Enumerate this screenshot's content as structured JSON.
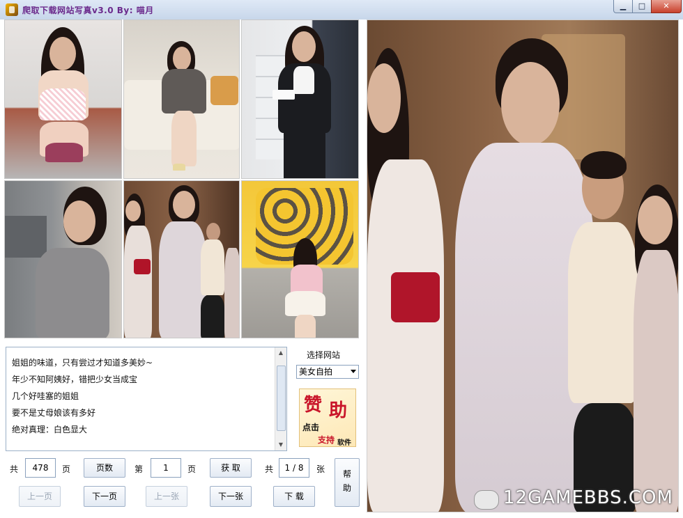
{
  "window": {
    "title": "爬取下载网站写真v3.0    By:  喵月",
    "minimize_glyph": "▁",
    "maximize_glyph": "□",
    "close_glyph": "✕"
  },
  "description": {
    "lines": [
      "姐姐的味道，只有尝过才知道多美妙~",
      "年少不知阿姨好，错把少女当成宝",
      "几个好哇塞的姐姐",
      "要不是丈母娘该有多好",
      "绝对真理：白色显大"
    ]
  },
  "site_select": {
    "label": "选择网站",
    "selected": "美女自拍"
  },
  "sponsor": {
    "big1": "赞",
    "big2": "助",
    "small1": "点击",
    "small2": "支持",
    "small3": "软件"
  },
  "pager": {
    "total_prefix": "共",
    "total_pages": "478",
    "pages_unit": "页",
    "pages_button": "页数",
    "current_prefix": "第",
    "current_page": "1",
    "current_unit": "页",
    "fetch_button": "获 取",
    "images_prefix": "共",
    "image_counter": "1 / 8",
    "images_unit": "张",
    "help_line1": "帮",
    "help_line2": "助",
    "prev_page": "上一页",
    "next_page": "下一页",
    "prev_image": "上一张",
    "next_image": "下一张",
    "download": "下 载"
  },
  "watermark": "12GAMEBBS.COM"
}
